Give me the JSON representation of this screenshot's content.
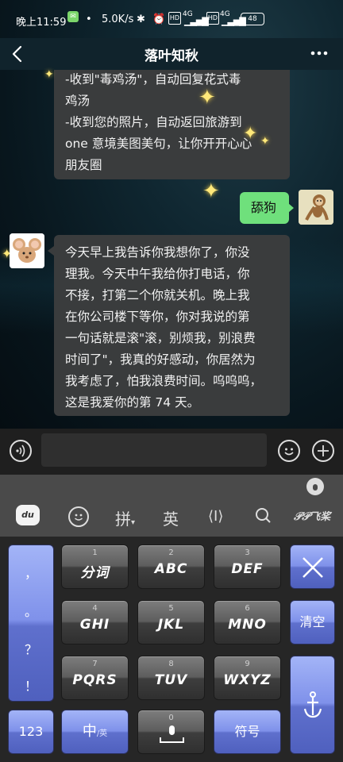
{
  "status_bar": {
    "time": "晚上11:59",
    "speed": "5.0K/s",
    "signal_hd1": "4G",
    "signal_hd2": "4G",
    "battery": "48"
  },
  "header": {
    "title": "落叶知秋",
    "back_icon": "back-arrow-icon",
    "more_icon": "more-dots-icon"
  },
  "messages": [
    {
      "side": "left",
      "lines": [
        "-收到\"毒鸡汤\"，自动回复花式毒",
        "鸡汤",
        "-收到您的照片，自动返回旅游到",
        "one 意境美图美句，让你开开心心",
        "朋友圈"
      ]
    },
    {
      "side": "right",
      "text": "舔狗"
    },
    {
      "side": "left",
      "lines": [
        "今天早上我告诉你我想你了，你没",
        "理我。今天中午我给你打电话，你",
        "不接，打第二个你就关机。晚上我",
        "在你公司楼下等你，你对我说的第",
        "一句话就是滚\"滚，别烦我，别浪费",
        "时间了\"，我真的好感动，你居然为",
        "我考虑了，怕我浪费时间。呜呜呜，",
        "这是我爱你的第 74 天。"
      ]
    }
  ],
  "input_bar": {
    "voice_icon": "voice-icon",
    "emoji_icon": "emoji-icon",
    "plus_icon": "plus-icon"
  },
  "keyboard": {
    "toolbar": {
      "logo": "du",
      "pinyin": "拼",
      "english": "英",
      "cursor": "⟨I⟩",
      "brand": "飞桨"
    },
    "left_column": [
      "，",
      "。",
      "？",
      "！"
    ],
    "keys": [
      {
        "num": "1",
        "label": "分词"
      },
      {
        "num": "2",
        "label": "ABC"
      },
      {
        "num": "3",
        "label": "DEF"
      },
      {
        "num": "4",
        "label": "GHI"
      },
      {
        "num": "5",
        "label": "JKL"
      },
      {
        "num": "6",
        "label": "MNO"
      },
      {
        "num": "7",
        "label": "PQRS"
      },
      {
        "num": "8",
        "label": "TUV"
      },
      {
        "num": "9",
        "label": "WXYZ"
      }
    ],
    "clear": "清空",
    "key_123": "123",
    "key_zhong": "中",
    "key_ying_small": "/英",
    "space_num": "0",
    "symbols": "符号"
  }
}
